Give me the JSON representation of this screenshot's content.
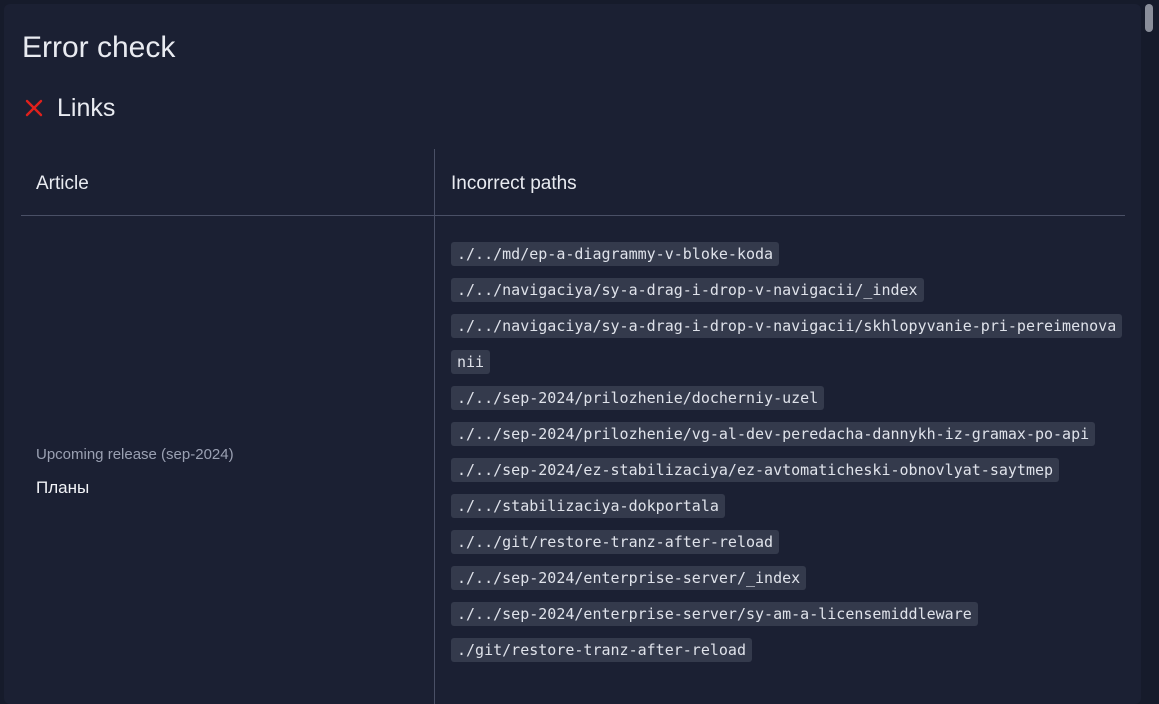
{
  "dialog": {
    "title": "Error check",
    "section": {
      "label": "Links",
      "icon": "close-x-icon",
      "icon_color": "#e0201c"
    }
  },
  "table": {
    "columns": [
      "Article",
      "Incorrect paths"
    ],
    "rows": [
      {
        "category": "Upcoming release (sep-2024)",
        "article": "Планы",
        "paths": [
          "./../md/ep-a-diagrammy-v-bloke-koda",
          "./../navigaciya/sy-a-drag-i-drop-v-navigacii/_index",
          "./../navigaciya/sy-a-drag-i-drop-v-navigacii/skhlopyvanie-pri-pereimenovanii",
          "./../sep-2024/prilozhenie/docherniy-uzel",
          "./../sep-2024/prilozhenie/vg-al-dev-peredacha-dannykh-iz-gramax-po-api",
          "./../sep-2024/ez-stabilizaciya/ez-avtomaticheski-obnovlyat-saytmep",
          "./../stabilizaciya-dokportala",
          "./../git/restore-tranz-after-reload",
          "./../sep-2024/enterprise-server/_index",
          "./../sep-2024/enterprise-server/sy-am-a-licensemiddleware",
          "./git/restore-tranz-after-reload"
        ]
      }
    ]
  }
}
